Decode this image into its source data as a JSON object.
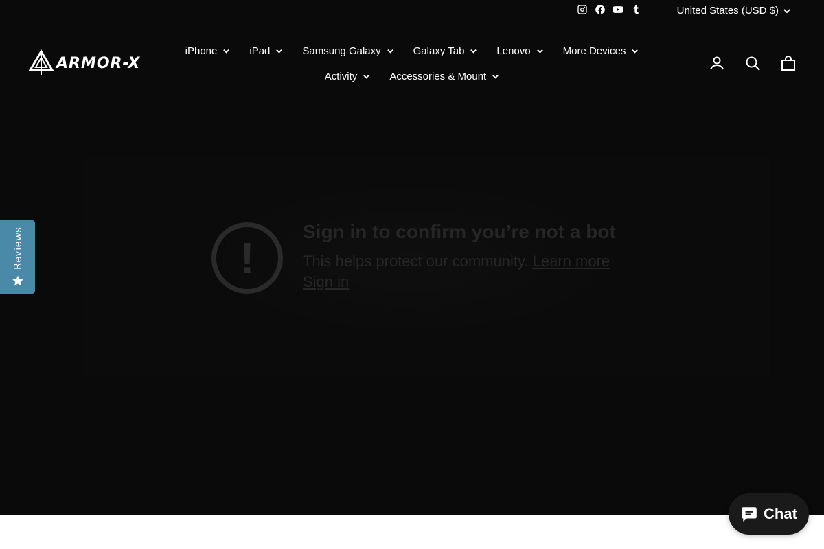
{
  "topbar": {
    "socials": [
      {
        "icon": "instagram-icon"
      },
      {
        "icon": "facebook-icon"
      },
      {
        "icon": "youtube-icon"
      },
      {
        "icon": "tumblr-icon"
      }
    ],
    "currency": "United States (USD $)"
  },
  "brand": {
    "logo_text": "ARMOR-X"
  },
  "nav": {
    "row1": [
      "iPhone",
      "iPad",
      "Samsung Galaxy",
      "Galaxy Tab",
      "Lenovo",
      "More Devices"
    ],
    "row2": [
      "Activity",
      "Accessories & Mount"
    ]
  },
  "header_icons": [
    "account-icon",
    "search-icon",
    "cart-icon"
  ],
  "embed": {
    "title": "Sign in to confirm you’re not a bot",
    "subtitle": "This helps protect our community.",
    "learn_more": "Learn more",
    "sign_in": "Sign in"
  },
  "reviews_tab": {
    "label": "Reviews"
  },
  "chat": {
    "label": "Chat"
  },
  "colors": {
    "hero_bg": "#0a0a0a",
    "reviews_tab": "#4b89a9",
    "chat_bg": "#1a1a1a"
  }
}
